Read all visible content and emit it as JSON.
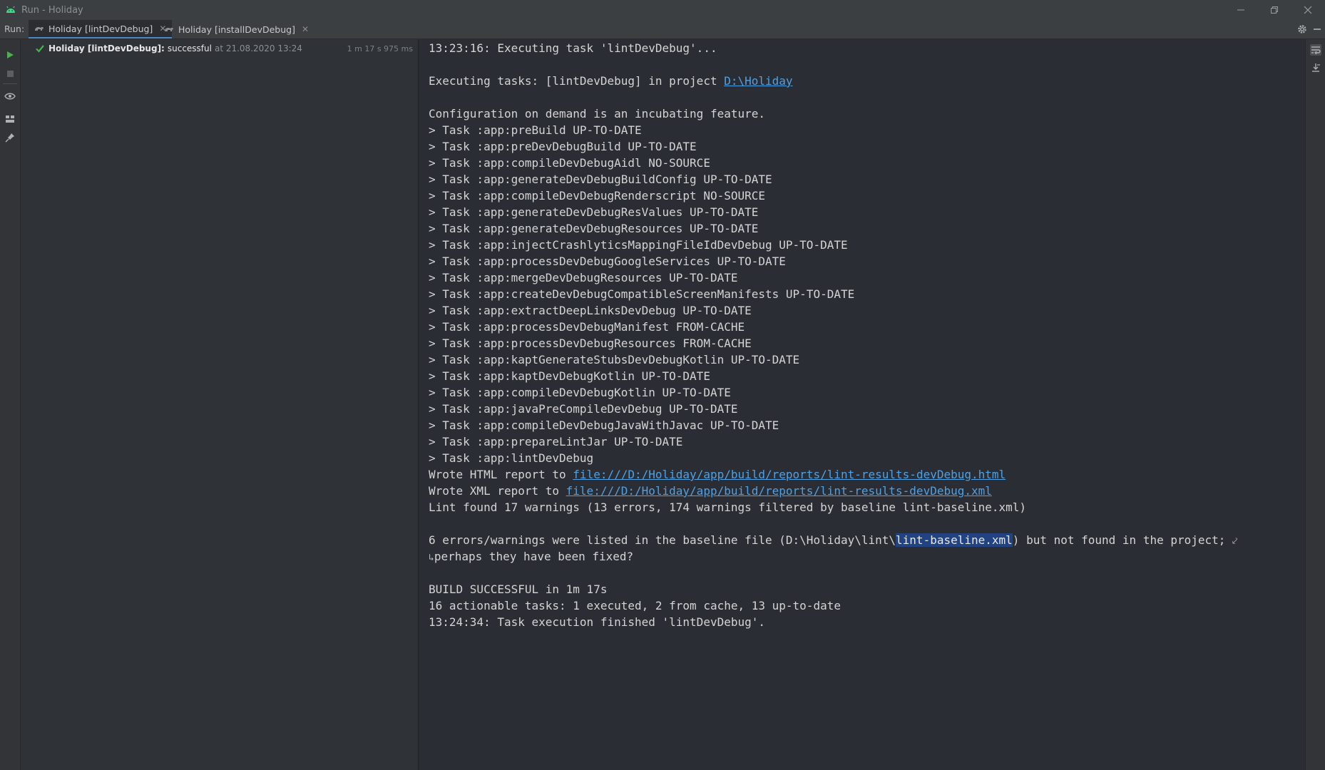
{
  "window": {
    "title": "Run - Holiday"
  },
  "run_bar": {
    "label": "Run:",
    "tabs": [
      {
        "label": "Holiday [lintDevDebug]",
        "active": true
      },
      {
        "label": "Holiday [installDevDebug]",
        "active": false
      }
    ]
  },
  "tree": {
    "item": {
      "name": "Holiday [lintDevDebug]:",
      "status": "successful",
      "time": "at 21.08.2020 13:24",
      "duration": "1 m 17 s 975 ms"
    }
  },
  "console": {
    "lines": [
      {
        "text": "13:23:16: Executing task 'lintDevDebug'..."
      },
      {
        "text": ""
      },
      {
        "prefix": "Executing tasks: [lintDevDebug] in project ",
        "link": "D:\\Holiday"
      },
      {
        "text": ""
      },
      {
        "text": "Configuration on demand is an incubating feature."
      },
      {
        "text": "> Task :app:preBuild UP-TO-DATE"
      },
      {
        "text": "> Task :app:preDevDebugBuild UP-TO-DATE"
      },
      {
        "text": "> Task :app:compileDevDebugAidl NO-SOURCE"
      },
      {
        "text": "> Task :app:generateDevDebugBuildConfig UP-TO-DATE"
      },
      {
        "text": "> Task :app:compileDevDebugRenderscript NO-SOURCE"
      },
      {
        "text": "> Task :app:generateDevDebugResValues UP-TO-DATE"
      },
      {
        "text": "> Task :app:generateDevDebugResources UP-TO-DATE"
      },
      {
        "text": "> Task :app:injectCrashlyticsMappingFileIdDevDebug UP-TO-DATE"
      },
      {
        "text": "> Task :app:processDevDebugGoogleServices UP-TO-DATE"
      },
      {
        "text": "> Task :app:mergeDevDebugResources UP-TO-DATE"
      },
      {
        "text": "> Task :app:createDevDebugCompatibleScreenManifests UP-TO-DATE"
      },
      {
        "text": "> Task :app:extractDeepLinksDevDebug UP-TO-DATE"
      },
      {
        "text": "> Task :app:processDevDebugManifest FROM-CACHE"
      },
      {
        "text": "> Task :app:processDevDebugResources FROM-CACHE"
      },
      {
        "text": "> Task :app:kaptGenerateStubsDevDebugKotlin UP-TO-DATE"
      },
      {
        "text": "> Task :app:kaptDevDebugKotlin UP-TO-DATE"
      },
      {
        "text": "> Task :app:compileDevDebugKotlin UP-TO-DATE"
      },
      {
        "text": "> Task :app:javaPreCompileDevDebug UP-TO-DATE"
      },
      {
        "text": "> Task :app:compileDevDebugJavaWithJavac UP-TO-DATE"
      },
      {
        "text": "> Task :app:prepareLintJar UP-TO-DATE"
      },
      {
        "text": "> Task :app:lintDevDebug"
      },
      {
        "prefix": "Wrote HTML report to ",
        "link": "file:///D:/Holiday/app/build/reports/lint-results-devDebug.html"
      },
      {
        "prefix": "Wrote XML report to ",
        "link": "file:///D:/Holiday/app/build/reports/lint-results-devDebug.xml"
      },
      {
        "text": "Lint found 17 warnings (13 errors, 174 warnings filtered by baseline lint-baseline.xml)"
      },
      {
        "text": ""
      },
      {
        "prefix": "6 errors/warnings were listed in the baseline file (D:\\Holiday\\lint\\",
        "selected": "lint-baseline.xml",
        "suffix": ") but not found in the project; ",
        "wrap_end": "⤦"
      },
      {
        "wrap_start": "↳",
        "text": "perhaps they have been fixed?"
      },
      {
        "text": ""
      },
      {
        "text": "BUILD SUCCESSFUL in 1m 17s"
      },
      {
        "text": "16 actionable tasks: 1 executed, 2 from cache, 13 up-to-date"
      },
      {
        "text": "13:24:34: Task execution finished 'lintDevDebug'."
      }
    ]
  },
  "colors": {
    "background": "#2b2d34",
    "link": "#4ea1e4",
    "selection": "#214283",
    "success": "#4caf50"
  }
}
